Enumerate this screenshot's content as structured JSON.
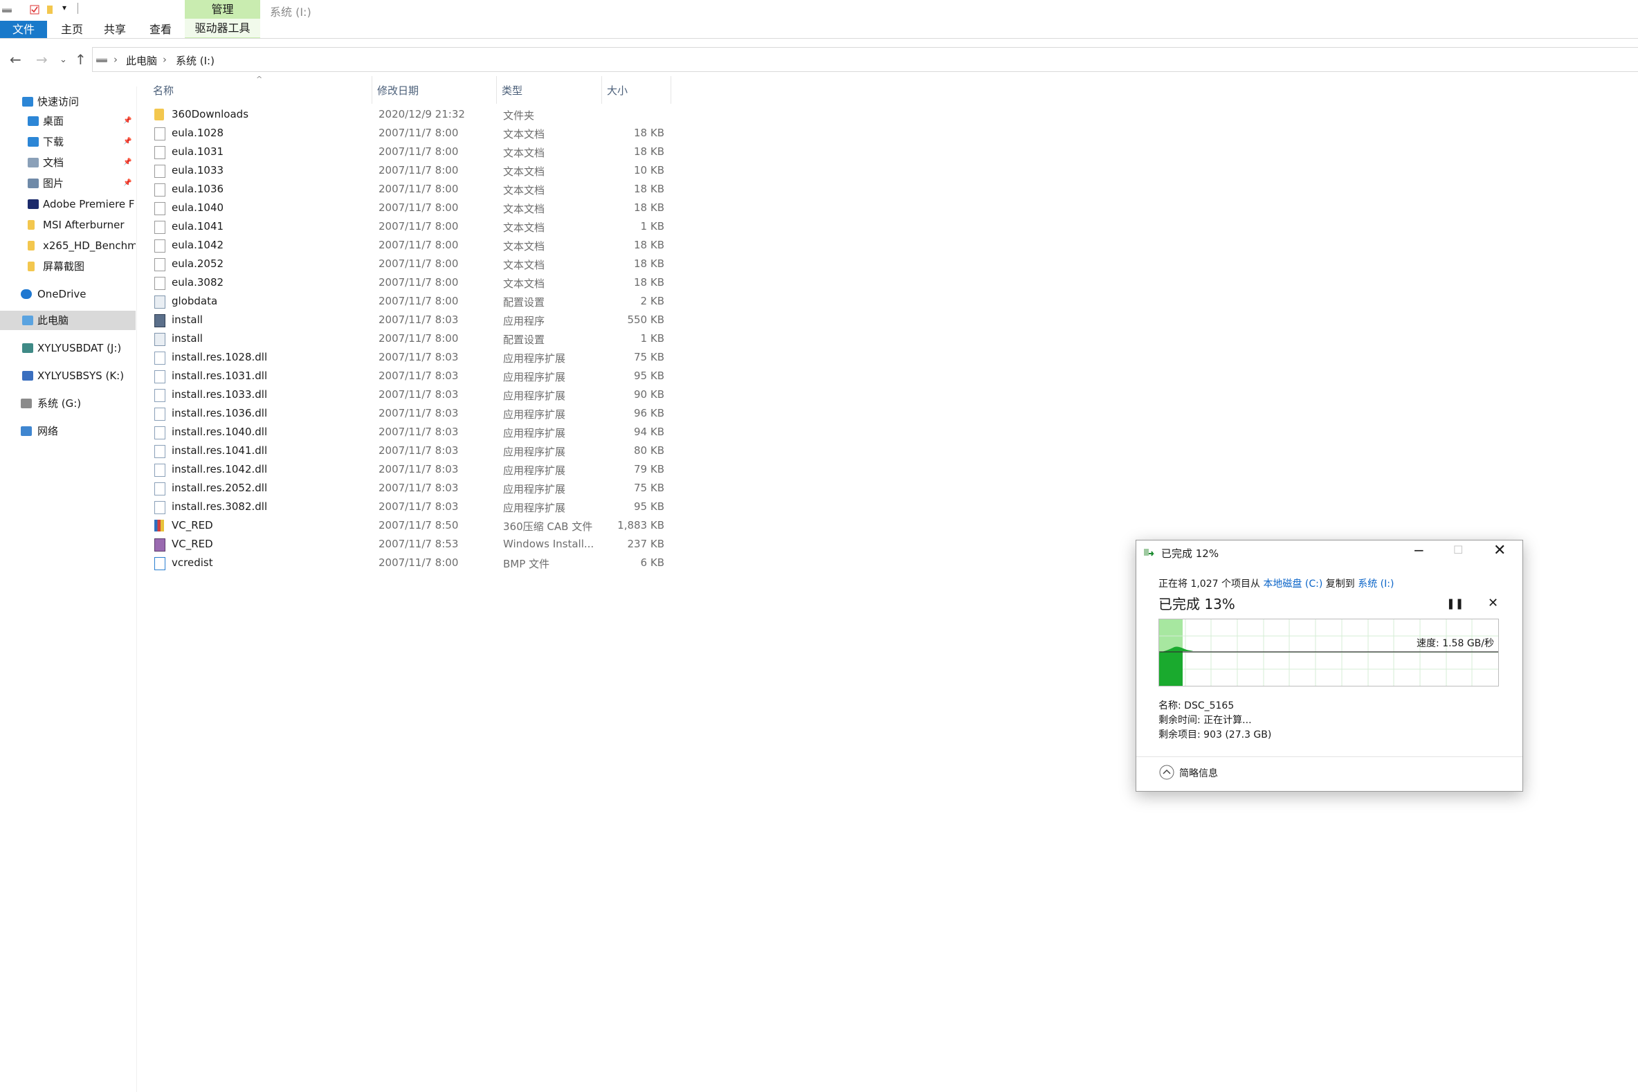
{
  "window": {
    "title": "系统 (I:)",
    "context_tab": "管理",
    "context_subtab": "驱动器工具"
  },
  "ribbon": {
    "tabs": [
      "文件",
      "主页",
      "共享",
      "查看"
    ]
  },
  "address_bar": {
    "breadcrumbs": [
      "此电脑",
      "系统 (I:)"
    ]
  },
  "sidebar": {
    "items": [
      {
        "label": "快速访问",
        "icon": "star-icon",
        "pinned": false
      },
      {
        "label": "桌面",
        "icon": "desktop-icon",
        "pinned": true
      },
      {
        "label": "下载",
        "icon": "download-icon",
        "pinned": true
      },
      {
        "label": "文档",
        "icon": "document-icon",
        "pinned": true
      },
      {
        "label": "图片",
        "icon": "picture-icon",
        "pinned": true
      },
      {
        "label": "Adobe Premiere F",
        "icon": "premiere-icon",
        "pinned": false
      },
      {
        "label": "MSI Afterburner",
        "icon": "folder-icon",
        "pinned": false
      },
      {
        "label": "x265_HD_Benchm",
        "icon": "folder-icon",
        "pinned": false
      },
      {
        "label": "屏幕截图",
        "icon": "folder-icon",
        "pinned": false
      },
      {
        "label": "OneDrive",
        "icon": "cloud-icon",
        "pinned": false
      },
      {
        "label": "此电脑",
        "icon": "computer-icon",
        "pinned": false
      },
      {
        "label": "XYLYUSBDAT (J:)",
        "icon": "dvd-drive-icon",
        "pinned": false
      },
      {
        "label": "XYLYUSBSYS (K:)",
        "icon": "usb-drive-icon",
        "pinned": false
      },
      {
        "label": "系统 (G:)",
        "icon": "drive-icon",
        "pinned": false
      },
      {
        "label": "网络",
        "icon": "network-icon",
        "pinned": false
      }
    ]
  },
  "columns": {
    "name": "名称",
    "date": "修改日期",
    "type": "类型",
    "size": "大小"
  },
  "files": [
    {
      "name": "360Downloads",
      "date": "2020/12/9 21:32",
      "type": "文件夹",
      "size": "",
      "icon": "folder-icon"
    },
    {
      "name": "eula.1028",
      "date": "2007/11/7 8:00",
      "type": "文本文档",
      "size": "18 KB",
      "icon": "text-file-icon"
    },
    {
      "name": "eula.1031",
      "date": "2007/11/7 8:00",
      "type": "文本文档",
      "size": "18 KB",
      "icon": "text-file-icon"
    },
    {
      "name": "eula.1033",
      "date": "2007/11/7 8:00",
      "type": "文本文档",
      "size": "10 KB",
      "icon": "text-file-icon"
    },
    {
      "name": "eula.1036",
      "date": "2007/11/7 8:00",
      "type": "文本文档",
      "size": "18 KB",
      "icon": "text-file-icon"
    },
    {
      "name": "eula.1040",
      "date": "2007/11/7 8:00",
      "type": "文本文档",
      "size": "18 KB",
      "icon": "text-file-icon"
    },
    {
      "name": "eula.1041",
      "date": "2007/11/7 8:00",
      "type": "文本文档",
      "size": "1 KB",
      "icon": "text-file-icon"
    },
    {
      "name": "eula.1042",
      "date": "2007/11/7 8:00",
      "type": "文本文档",
      "size": "18 KB",
      "icon": "text-file-icon"
    },
    {
      "name": "eula.2052",
      "date": "2007/11/7 8:00",
      "type": "文本文档",
      "size": "18 KB",
      "icon": "text-file-icon"
    },
    {
      "name": "eula.3082",
      "date": "2007/11/7 8:00",
      "type": "文本文档",
      "size": "18 KB",
      "icon": "text-file-icon"
    },
    {
      "name": "globdata",
      "date": "2007/11/7 8:00",
      "type": "配置设置",
      "size": "2 KB",
      "icon": "config-file-icon"
    },
    {
      "name": "install",
      "date": "2007/11/7 8:03",
      "type": "应用程序",
      "size": "550 KB",
      "icon": "application-icon"
    },
    {
      "name": "install",
      "date": "2007/11/7 8:00",
      "type": "配置设置",
      "size": "1 KB",
      "icon": "config-file-icon"
    },
    {
      "name": "install.res.1028.dll",
      "date": "2007/11/7 8:03",
      "type": "应用程序扩展",
      "size": "75 KB",
      "icon": "dll-file-icon"
    },
    {
      "name": "install.res.1031.dll",
      "date": "2007/11/7 8:03",
      "type": "应用程序扩展",
      "size": "95 KB",
      "icon": "dll-file-icon"
    },
    {
      "name": "install.res.1033.dll",
      "date": "2007/11/7 8:03",
      "type": "应用程序扩展",
      "size": "90 KB",
      "icon": "dll-file-icon"
    },
    {
      "name": "install.res.1036.dll",
      "date": "2007/11/7 8:03",
      "type": "应用程序扩展",
      "size": "96 KB",
      "icon": "dll-file-icon"
    },
    {
      "name": "install.res.1040.dll",
      "date": "2007/11/7 8:03",
      "type": "应用程序扩展",
      "size": "94 KB",
      "icon": "dll-file-icon"
    },
    {
      "name": "install.res.1041.dll",
      "date": "2007/11/7 8:03",
      "type": "应用程序扩展",
      "size": "80 KB",
      "icon": "dll-file-icon"
    },
    {
      "name": "install.res.1042.dll",
      "date": "2007/11/7 8:03",
      "type": "应用程序扩展",
      "size": "79 KB",
      "icon": "dll-file-icon"
    },
    {
      "name": "install.res.2052.dll",
      "date": "2007/11/7 8:03",
      "type": "应用程序扩展",
      "size": "75 KB",
      "icon": "dll-file-icon"
    },
    {
      "name": "install.res.3082.dll",
      "date": "2007/11/7 8:03",
      "type": "应用程序扩展",
      "size": "95 KB",
      "icon": "dll-file-icon"
    },
    {
      "name": "VC_RED",
      "date": "2007/11/7 8:50",
      "type": "360压缩 CAB 文件",
      "size": "1,883 KB",
      "icon": "cab-archive-icon"
    },
    {
      "name": "VC_RED",
      "date": "2007/11/7 8:53",
      "type": "Windows Install...",
      "size": "237 KB",
      "icon": "installer-package-icon"
    },
    {
      "name": "vcredist",
      "date": "2007/11/7 8:00",
      "type": "BMP 文件",
      "size": "6 KB",
      "icon": "bitmap-file-icon"
    }
  ],
  "copy_dialog": {
    "title": "已完成 12%",
    "desc_prefix": "正在将 1,027 个项目从",
    "source": "本地磁盘 (C:)",
    "desc_mid": "复制到",
    "target": "系统 (I:)",
    "progress_label": "已完成 13%",
    "progress_fraction": 0.13,
    "speed": "速度: 1.58 GB/秒",
    "name_line": "名称:  DSC_5165",
    "time_line": "剩余时间:  正在计算...",
    "items_line": "剩余项目:  903 (27.3 GB)",
    "less_details": "简略信息"
  },
  "colors": {
    "accent": "#1979ca",
    "context_tab": "#c9ecb0",
    "progress_fill": "#1aaa2e",
    "progress_light": "#a7e7a0",
    "link": "#0a64c8"
  }
}
